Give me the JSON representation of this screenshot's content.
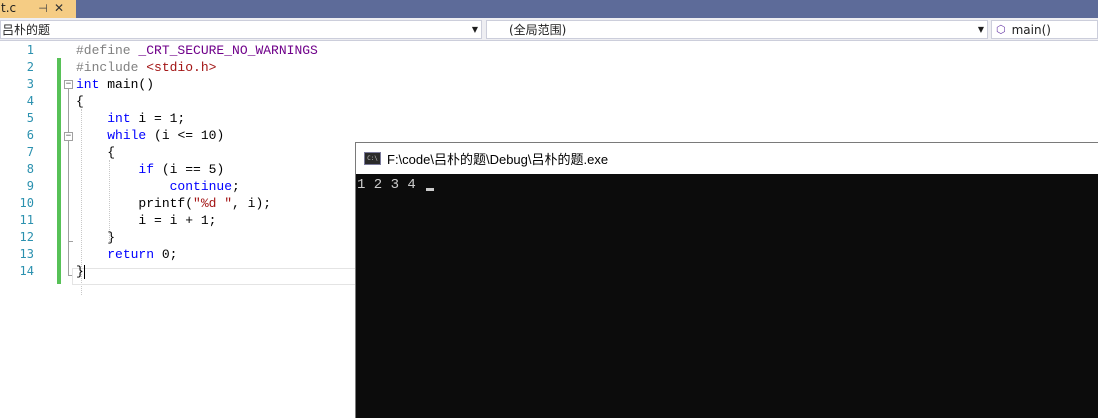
{
  "tab": {
    "label": "t.c",
    "pin_glyph": "⊣",
    "close_glyph": "✕",
    "pin_icon": "pin-icon",
    "close_icon": "close-icon"
  },
  "navbar": {
    "project": "吕朴的题",
    "scope": "(全局范围)",
    "member": "main()",
    "chevron_icon": "chevron-down-icon",
    "member_icon": "function-cube-icon"
  },
  "editor": {
    "line_numbers": [
      "1",
      "2",
      "3",
      "4",
      "5",
      "6",
      "7",
      "8",
      "9",
      "10",
      "11",
      "12",
      "13",
      "14"
    ],
    "lines": [
      [
        {
          "t": "#define ",
          "c": "pp"
        },
        {
          "t": "_CRT_SECURE_NO_WARNINGS",
          "c": "mac"
        }
      ],
      [
        {
          "t": "#include ",
          "c": "pp"
        },
        {
          "t": "<stdio.h>",
          "c": "str"
        }
      ],
      [
        {
          "t": "int",
          "c": "kw"
        },
        {
          "t": " main()",
          "c": ""
        }
      ],
      [
        {
          "t": "{",
          "c": ""
        }
      ],
      [
        {
          "t": "    ",
          "c": ""
        },
        {
          "t": "int",
          "c": "kw"
        },
        {
          "t": " i = 1;",
          "c": ""
        }
      ],
      [
        {
          "t": "    ",
          "c": ""
        },
        {
          "t": "while",
          "c": "kw"
        },
        {
          "t": " (i <= 10)",
          "c": ""
        }
      ],
      [
        {
          "t": "    {",
          "c": ""
        }
      ],
      [
        {
          "t": "        ",
          "c": ""
        },
        {
          "t": "if",
          "c": "kw"
        },
        {
          "t": " (i == 5)",
          "c": ""
        }
      ],
      [
        {
          "t": "            ",
          "c": ""
        },
        {
          "t": "continue",
          "c": "kw"
        },
        {
          "t": ";",
          "c": ""
        }
      ],
      [
        {
          "t": "        printf(",
          "c": ""
        },
        {
          "t": "\"%d \"",
          "c": "str"
        },
        {
          "t": ", i);",
          "c": ""
        }
      ],
      [
        {
          "t": "        i = i + 1;",
          "c": ""
        }
      ],
      [
        {
          "t": "    }",
          "c": ""
        }
      ],
      [
        {
          "t": "    ",
          "c": ""
        },
        {
          "t": "return",
          "c": "kw"
        },
        {
          "t": " 0;",
          "c": ""
        }
      ],
      [
        {
          "t": "}",
          "c": ""
        }
      ]
    ],
    "colors": {
      "keyword": "#0000ff",
      "preprocessor": "#808080",
      "macro": "#6f008a",
      "string": "#a31515",
      "line_number": "#2b91af",
      "change_bar": "#57c157"
    }
  },
  "console": {
    "title": "F:\\code\\吕朴的题\\Debug\\吕朴的题.exe",
    "icon_text": "C:\\",
    "output": "1 2 3 4 ",
    "app_icon": "console-app-icon"
  }
}
